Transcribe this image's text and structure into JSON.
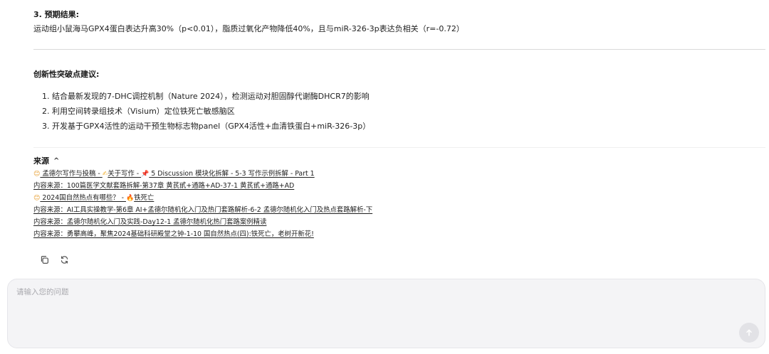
{
  "result": {
    "title": "3. 预期结果:",
    "text": "运动组小鼠海马GPX4蛋白表达升高30%（p<0.01），脂质过氧化产物降低40%，且与miR-326-3p表达负相关（r=-0.72）"
  },
  "innovation": {
    "title": "创新性突破点建议:",
    "items": [
      "1. 结合最新发现的7-DHC调控机制（Nature 2024），检测运动对胆固醇代谢酶DHCR7的影响",
      "2. 利用空间转录组技术（Visium）定位铁死亡敏感脑区",
      "3. 开发基于GPX4活性的运动干预生物标志物panel（GPX4活性+血清铁蛋白+miR-326-3p）"
    ]
  },
  "sources": {
    "title": "来源",
    "toggle_glyph": "^",
    "items": [
      {
        "segments": [
          {
            "icon": "face-emoji-icon",
            "glyph": "😊"
          },
          {
            "text": " 孟德尔写作与投稿 - "
          },
          {
            "icon": "writing-hand-icon",
            "glyph": "✍"
          },
          {
            "text": "关于写作 - "
          },
          {
            "icon": "pushpin-icon",
            "glyph": "📌"
          },
          {
            "text": " 5 Discussion 模块化拆解 - 5-3 写作示例拆解 - Part 1"
          }
        ]
      },
      {
        "segments": [
          {
            "text": "内容来源：100篇医学文献套路拆解-第37章 黄芪甙+通路+AD-37-1 黄芪甙+通路+AD"
          }
        ]
      },
      {
        "segments": [
          {
            "icon": "face-emoji-icon",
            "glyph": "😊"
          },
          {
            "text": " 2024国自然热点有哪些？ - "
          },
          {
            "icon": "fire-icon",
            "glyph": "🔥"
          },
          {
            "text": "铁死亡"
          }
        ]
      },
      {
        "segments": [
          {
            "text": "内容来源：AI工具实操教学-第6章 AI+孟德尔随机化入门及热门套路解析-6-2 孟德尔随机化入门及热点套路解析-下"
          }
        ]
      },
      {
        "segments": [
          {
            "text": "内容来源：孟德尔随机化入门及实践-Day12-1 孟德尔随机化热门套路案例精读"
          }
        ]
      },
      {
        "segments": [
          {
            "text": "内容来源：勇攀高峰，聚焦2024基础科研殿堂之钟-1-10 国自然热点(四):铁死亡，老树开新花!"
          }
        ]
      }
    ]
  },
  "actions": [
    {
      "name": "copy-button",
      "icon": "copy-icon"
    },
    {
      "name": "regenerate-button",
      "icon": "refresh-icon"
    }
  ],
  "input": {
    "placeholder": "请输入您的问题",
    "value": ""
  },
  "send_button": {
    "icon": "arrow-up-icon"
  }
}
